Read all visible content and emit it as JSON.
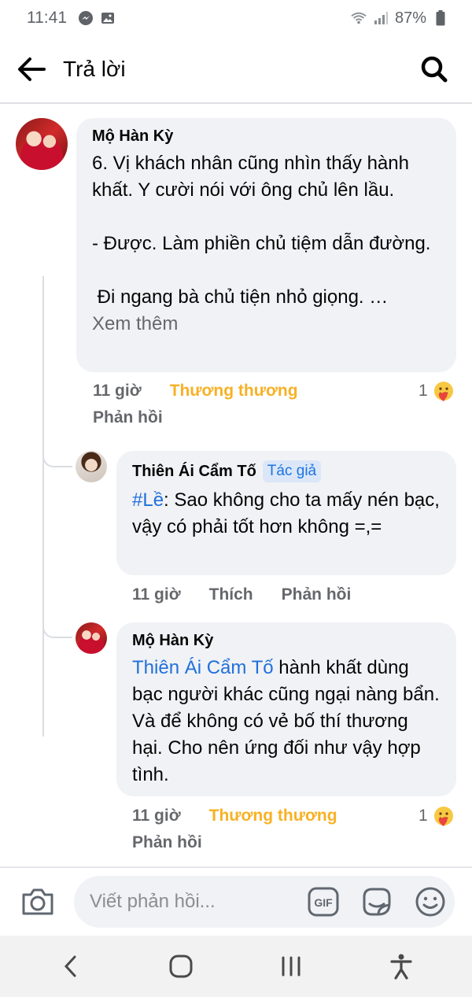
{
  "status_bar": {
    "time": "11:41",
    "battery": "87%"
  },
  "header": {
    "title": "Trả lời"
  },
  "comments": [
    {
      "author": "Mộ Hàn Kỳ",
      "text": "6. Vị khách nhân cũng nhìn thấy hành khất. Y cười nói với ông chủ lên lầu.\n\n- Được. Làm phiền chủ tiệm dẫn đường.\n\n Đi ngang bà chủ tiện nhỏ giọng. …",
      "see_more": "Xem thêm",
      "time": "11 giờ",
      "reaction_label": "Thương thương",
      "reaction_count": "1",
      "reply_label": "Phản hồi"
    },
    {
      "author": "Thiên Ái Cẩm Tố",
      "badge": "Tác giả",
      "mention": "#Lề",
      "text": ": Sao không cho ta mấy nén bạc, vậy có phải tốt hơn không =,=",
      "time": "11 giờ",
      "like_label": "Thích",
      "reply_label": "Phản hồi"
    },
    {
      "author": "Mộ Hàn Kỳ",
      "mention": "Thiên Ái Cẩm Tố",
      "text": " hành khất dùng bạc người khác cũng ngại nàng bẩn. Và để không có vẻ bố thí thương hại. Cho nên ứng đối như vậy hợp tình.",
      "time": "11 giờ",
      "reaction_label": "Thương thương",
      "reaction_count": "1",
      "reply_label": "Phản hồi"
    }
  ],
  "composer": {
    "placeholder": "Viết phản hồi..."
  },
  "icons": {
    "back": "arrow-left-icon",
    "search": "search-icon",
    "camera": "camera-icon",
    "gif": "gif-icon",
    "sticker": "sticker-icon",
    "emoji": "emoji-icon",
    "care": "care-reaction-icon"
  },
  "colors": {
    "reaction": "#f7b125",
    "mention": "#216fdb",
    "bubble": "#f0f2f5"
  }
}
